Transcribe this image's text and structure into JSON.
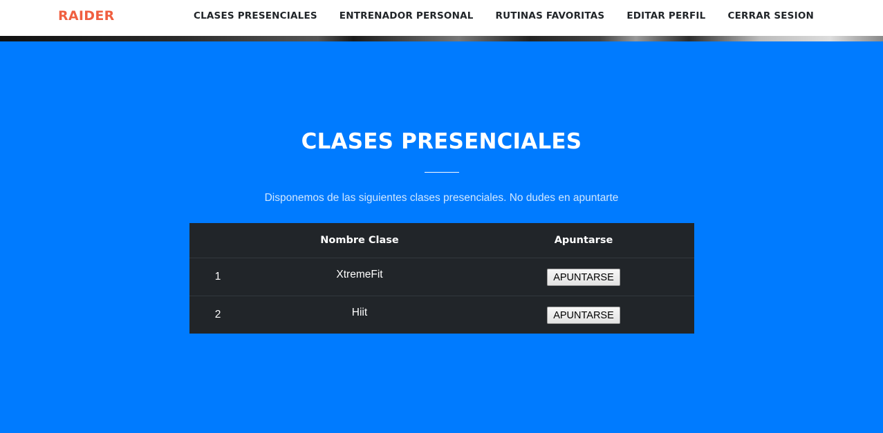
{
  "navbar": {
    "brand": "RAIDER",
    "links": [
      {
        "label": "CLASES PRESENCIALES"
      },
      {
        "label": "ENTRENADOR PERSONAL"
      },
      {
        "label": "RUTINAS FAVORITAS"
      },
      {
        "label": "EDITAR PERFIL"
      },
      {
        "label": "CERRAR SESION"
      }
    ]
  },
  "colors": {
    "brand": "#f05f40",
    "section_bg": "#007bff",
    "table_bg": "#212529",
    "nav_text": "#212529"
  },
  "section": {
    "title": "CLASES PRESENCIALES",
    "subtitle": "Disponemos de las siguientes clases presenciales. No dudes en apuntarte"
  },
  "table": {
    "headers": [
      "",
      "Nombre Clase",
      "Apuntarse"
    ],
    "rows": [
      {
        "num": "1",
        "name": "XtremeFit",
        "button": "APUNTARSE"
      },
      {
        "num": "2",
        "name": "Hiit",
        "button": "APUNTARSE"
      }
    ]
  }
}
